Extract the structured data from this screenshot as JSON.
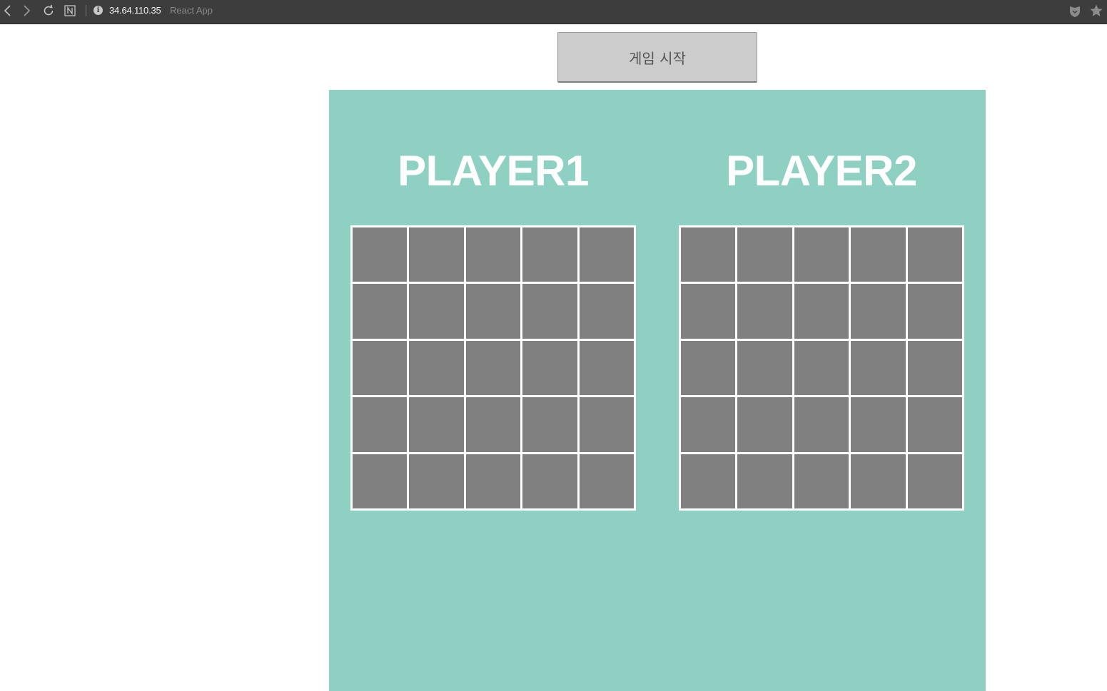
{
  "browser": {
    "url_host": "34.64.110.35",
    "page_title": "React App",
    "info_glyph": "i",
    "icons": [
      "back-arrow-icon",
      "forward-arrow-icon",
      "reload-icon",
      "notion-n-icon",
      "info-icon",
      "shield-extension-icon",
      "bookmark-star-icon"
    ]
  },
  "game": {
    "start_button_label": "게임 시작",
    "panel_color": "#8ed1c3",
    "cell_color": "#808080",
    "players": [
      {
        "title": "PLAYER1",
        "rows": 5,
        "cols": 5
      },
      {
        "title": "PLAYER2",
        "rows": 5,
        "cols": 5
      }
    ]
  }
}
